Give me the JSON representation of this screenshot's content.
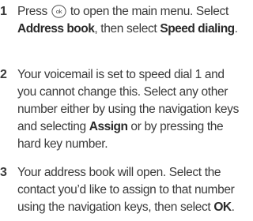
{
  "steps": [
    {
      "number": "1",
      "t1": "Press",
      "ok_icon_label": "ok",
      "t2": "to open the main menu. Select",
      "b1": "Address book",
      "t3": ", then select",
      "b2": "Speed dialing",
      "t4": "."
    },
    {
      "number": "2",
      "t1": "Your voicemail is set to speed dial 1 and you cannot change this. Select any other number either by using the navigation keys and selecting",
      "b1": "Assign",
      "t2": "or by pressing the hard key number."
    },
    {
      "number": "3",
      "t1": "Your address book will open. Select the contact you’d like to assign to that number using the navigation keys, then select",
      "b1": "OK",
      "t2": "."
    }
  ]
}
